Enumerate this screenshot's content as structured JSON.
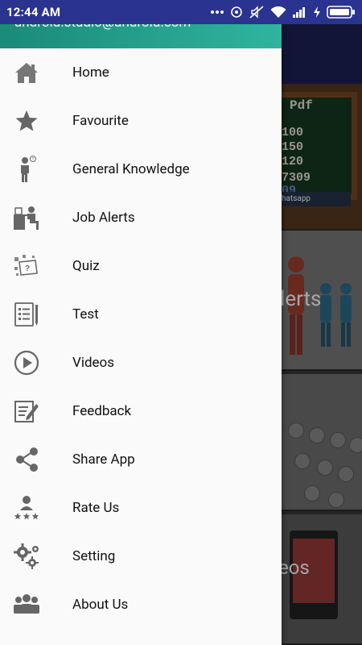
{
  "status_bar": {
    "time": "12:44 AM",
    "icons": [
      "more-dots-icon",
      "location-icon",
      "mute-icon",
      "wifi-icon",
      "signal-icon",
      "charging-icon",
      "battery-icon"
    ]
  },
  "drawer": {
    "header_email": "android.studio@android.com",
    "header_color": "#2fb4a0",
    "items": [
      {
        "label": "Home",
        "icon": "home-icon"
      },
      {
        "label": "Favourite",
        "icon": "star-icon"
      },
      {
        "label": "General Knowledge",
        "icon": "gk-person-icon"
      },
      {
        "label": "Job Alerts",
        "icon": "job-desk-icon"
      },
      {
        "label": "Quiz",
        "icon": "quiz-icon"
      },
      {
        "label": "Test",
        "icon": "test-paper-icon"
      },
      {
        "label": "Videos",
        "icon": "play-circle-icon"
      },
      {
        "label": "Feedback",
        "icon": "feedback-icon"
      },
      {
        "label": "Share App",
        "icon": "share-icon"
      },
      {
        "label": "Rate Us",
        "icon": "rate-us-icon"
      },
      {
        "label": "Setting",
        "icon": "gears-icon"
      },
      {
        "label": "About Us",
        "icon": "group-icon"
      }
    ]
  },
  "background_app": {
    "board_title": "Pdf",
    "board_numbers": [
      "100",
      "150",
      "120",
      "7309"
    ],
    "board_highlight": "09",
    "board_footer": "hatsapp",
    "card_label": "lerts",
    "video_label": "eos"
  }
}
